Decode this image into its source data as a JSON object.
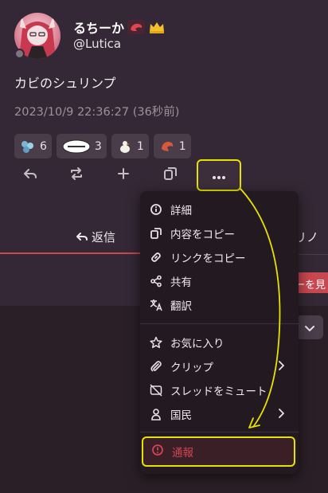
{
  "user": {
    "display_name": "るちーか",
    "username": "@Lutica",
    "name_emojis": [
      "shrimp-emoji",
      "crown-emoji"
    ]
  },
  "note": {
    "text": "カビのシュリンプ",
    "timestamp": "2023/10/9 22:36:27 (36秒前)"
  },
  "reactions": [
    {
      "emoji": "custom-emoji-1",
      "count": "6"
    },
    {
      "emoji": "custom-emoji-2",
      "count": "3"
    },
    {
      "emoji": "custom-emoji-3",
      "count": "1"
    },
    {
      "emoji": "shrimp-emoji",
      "count": "1"
    }
  ],
  "actions": [
    "reply-icon",
    "renote-icon",
    "plus-icon",
    "quote-icon",
    "more-icon"
  ],
  "tabs": {
    "reply": "返信",
    "other": "リノ"
  },
  "see_more": "ーを見",
  "menu": {
    "items": [
      {
        "icon": "info-icon",
        "label": "詳細"
      },
      {
        "icon": "copy-icon",
        "label": "内容をコピー"
      },
      {
        "icon": "link-icon",
        "label": "リンクをコピー"
      },
      {
        "icon": "share-icon",
        "label": "共有"
      },
      {
        "icon": "translate-icon",
        "label": "翻訳"
      },
      {
        "icon": "star-icon",
        "label": "お気に入り"
      },
      {
        "icon": "paperclip-icon",
        "label": "クリップ"
      },
      {
        "icon": "mute-thread-icon",
        "label": "スレッドをミュート"
      },
      {
        "icon": "person-icon",
        "label": "国民"
      }
    ],
    "danger": {
      "icon": "report-icon",
      "label": "通報"
    }
  },
  "colors": {
    "accent": "#c9474f",
    "highlight": "#e6e100",
    "danger": "#d14553"
  }
}
